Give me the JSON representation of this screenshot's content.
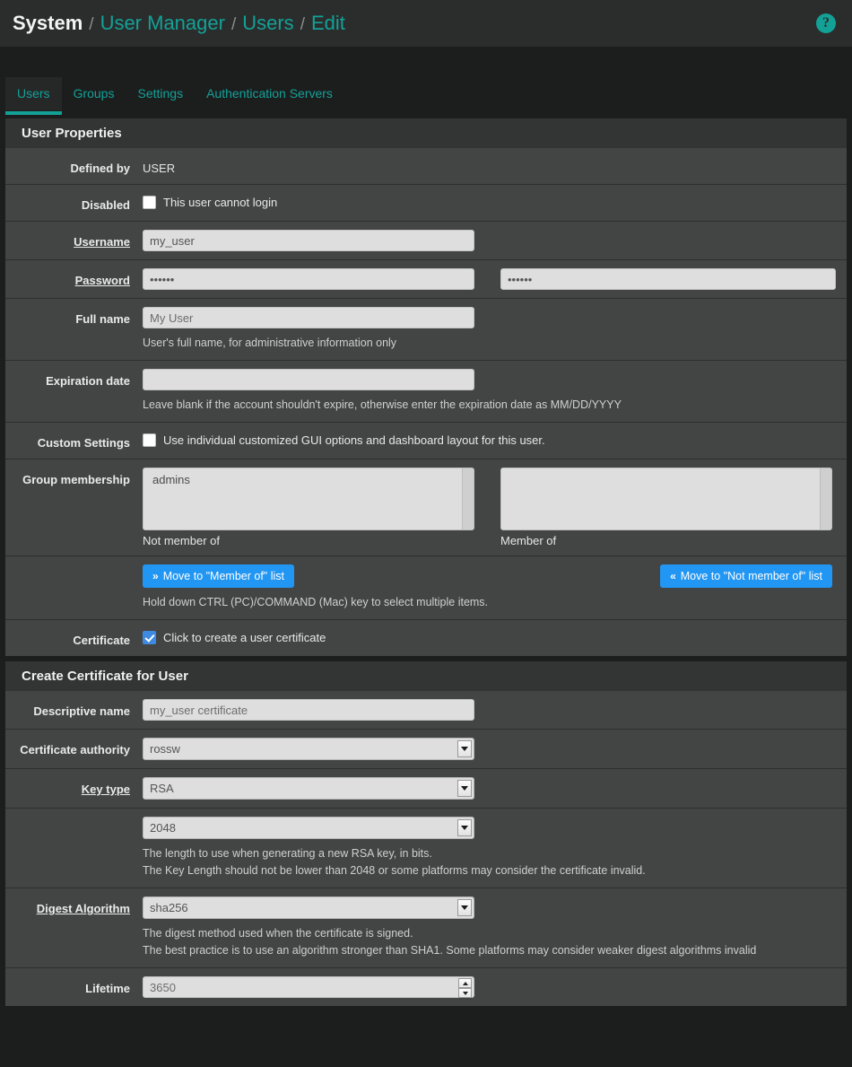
{
  "header": {
    "breadcrumb": [
      {
        "label": "System",
        "root": true
      },
      {
        "label": "User Manager",
        "root": false
      },
      {
        "label": "Users",
        "root": false
      },
      {
        "label": "Edit",
        "root": false
      }
    ],
    "separator": "/",
    "help_icon": "help-circle-icon",
    "help_glyph": "?",
    "accent_color": "#13a197"
  },
  "tabs": [
    {
      "label": "Users",
      "active": true
    },
    {
      "label": "Groups",
      "active": false
    },
    {
      "label": "Settings",
      "active": false
    },
    {
      "label": "Authentication Servers",
      "active": false
    }
  ],
  "user_properties": {
    "panel_title": "User Properties",
    "defined_by": {
      "label": "Defined by",
      "value": "USER"
    },
    "disabled": {
      "label": "Disabled",
      "checkbox_label": "This user cannot login",
      "checked": false
    },
    "username": {
      "label": "Username",
      "required": true,
      "value": "my_user"
    },
    "password": {
      "label": "Password",
      "required": true,
      "value": "••••••",
      "confirm_value": "••••••"
    },
    "full_name": {
      "label": "Full name",
      "value": "My User",
      "help": "User's full name, for administrative information only"
    },
    "expiration_date": {
      "label": "Expiration date",
      "value": "",
      "help": "Leave blank if the account shouldn't expire, otherwise enter the expiration date as MM/DD/YYYY"
    },
    "custom_settings": {
      "label": "Custom Settings",
      "checkbox_label": "Use individual customized GUI options and dashboard layout for this user.",
      "checked": false
    },
    "group_membership": {
      "label": "Group membership",
      "not_member_options": [
        "admins"
      ],
      "member_options": [],
      "not_member_caption": "Not member of",
      "member_caption": "Member of",
      "move_to_member_label": "Move to \"Member of\" list",
      "move_to_not_member_label": "Move to \"Not member of\" list",
      "move_right_icon": "chevron-double-right-icon",
      "move_left_icon": "chevron-double-left-icon",
      "move_right_glyph": "»",
      "move_left_glyph": "«",
      "help": "Hold down CTRL (PC)/COMMAND (Mac) key to select multiple items."
    },
    "certificate": {
      "label": "Certificate",
      "checkbox_label": "Click to create a user certificate",
      "checked": true
    }
  },
  "create_certificate": {
    "panel_title": "Create Certificate for User",
    "descriptive_name": {
      "label": "Descriptive name",
      "value": "my_user certificate"
    },
    "certificate_authority": {
      "label": "Certificate authority",
      "value": "rossw"
    },
    "key_type": {
      "label": "Key type",
      "required": true,
      "value": "RSA"
    },
    "key_length": {
      "label": "",
      "value": "2048",
      "help_line1": "The length to use when generating a new RSA key, in bits.",
      "help_line2": "The Key Length should not be lower than 2048 or some platforms may consider the certificate invalid."
    },
    "digest_algorithm": {
      "label": "Digest Algorithm",
      "required": true,
      "value": "sha256",
      "help_line1": "The digest method used when the certificate is signed.",
      "help_line2": "The best practice is to use an algorithm stronger than SHA1. Some platforms may consider weaker digest algorithms invalid"
    },
    "lifetime": {
      "label": "Lifetime",
      "value": "3650"
    }
  }
}
